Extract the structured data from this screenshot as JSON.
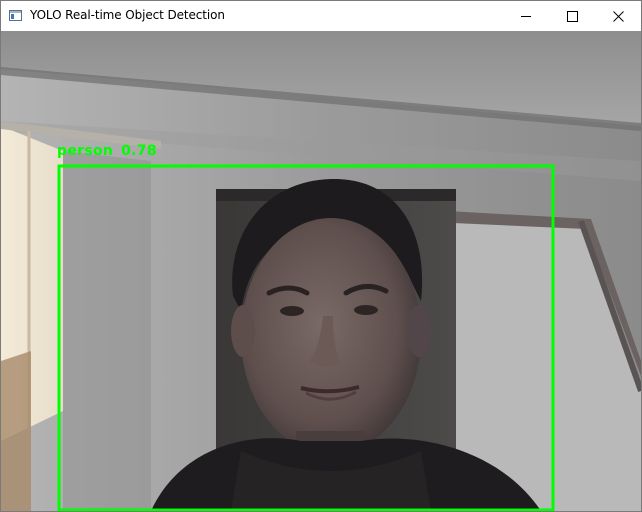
{
  "window": {
    "title": "YOLO Real-time Object Detection",
    "controls": {
      "minimize": "minimize",
      "maximize": "maximize",
      "close": "close"
    }
  },
  "detection": {
    "class_label": "person",
    "confidence": "0.78",
    "box_color": "#00ff00"
  },
  "icons": {
    "app": "window-app-icon",
    "minimize": "minimize-icon",
    "maximize": "maximize-icon",
    "close": "close-icon"
  }
}
